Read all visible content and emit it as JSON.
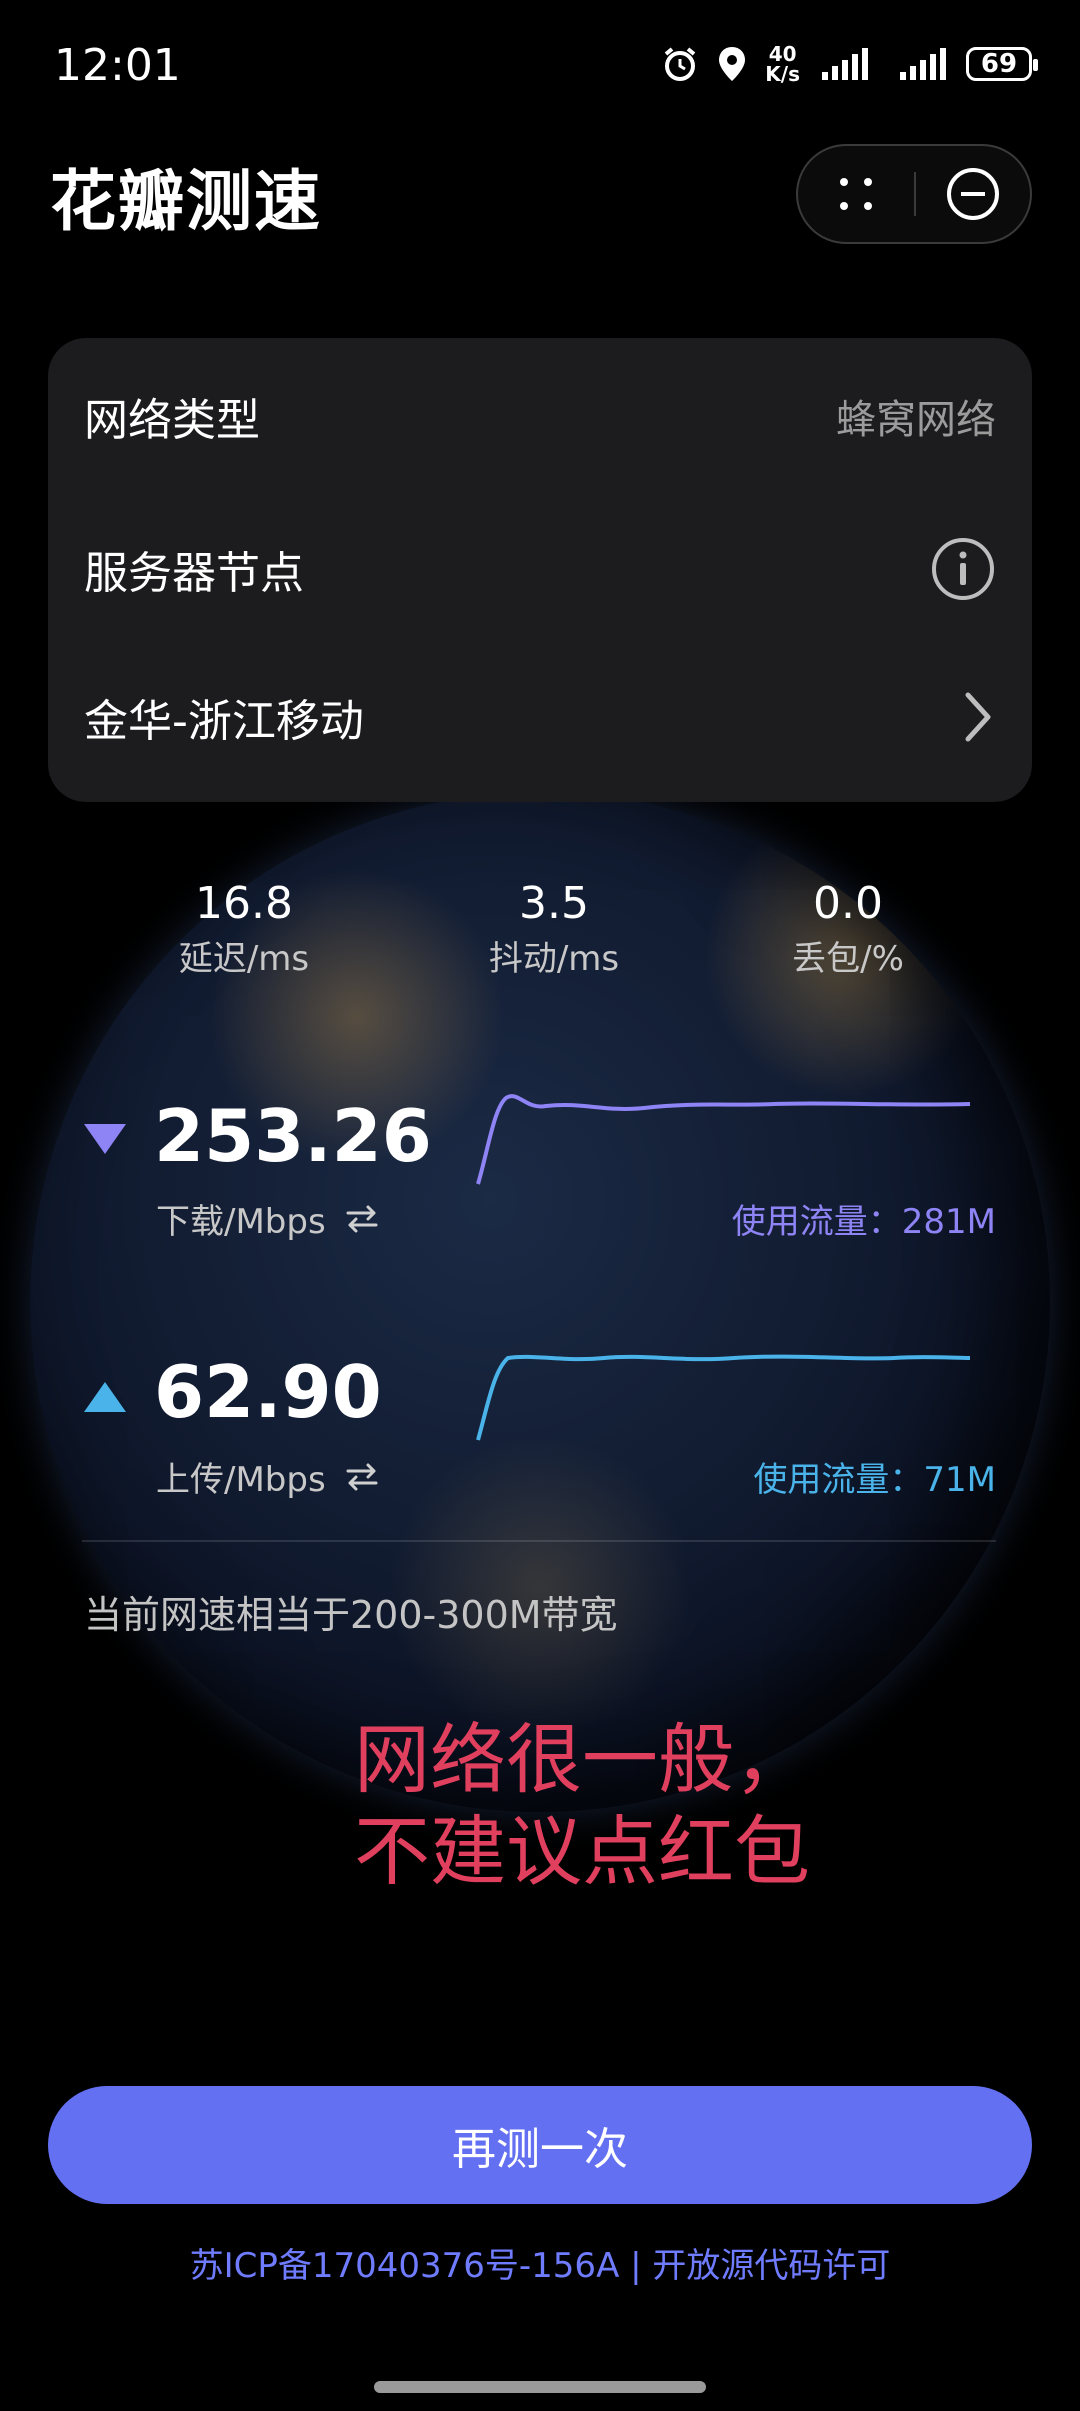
{
  "status_bar": {
    "time": "12:01",
    "net_speed_value": "40",
    "net_speed_unit": "K/s",
    "battery": "69",
    "icons": [
      "alarm-icon",
      "location-icon",
      "signal-icon",
      "signal-icon",
      "battery-icon"
    ]
  },
  "header": {
    "title": "花瓣测速",
    "more_icon": "more-dots-icon",
    "close_icon": "close-circle-icon"
  },
  "network_card": {
    "type_label": "网络类型",
    "type_value": "蜂窝网络",
    "server_label": "服务器节点",
    "server_info_icon": "info-icon",
    "server_name": "金华-浙江移动",
    "server_chevron_icon": "chevron-right-icon"
  },
  "metrics": {
    "latency": {
      "value": "16.8",
      "label": "延迟/ms"
    },
    "jitter": {
      "value": "3.5",
      "label": "抖动/ms"
    },
    "loss": {
      "value": "0.0",
      "label": "丢包/%"
    }
  },
  "download": {
    "value": "253.26",
    "label": "下载/Mbps",
    "traffic": "使用流量：281M",
    "color": "#8f84f5"
  },
  "upload": {
    "value": "62.90",
    "label": "上传/Mbps",
    "traffic": "使用流量：71M",
    "color": "#4ab3ea"
  },
  "bandwidth_note": "当前网速相当于200-300M带宽",
  "warning": {
    "line1": "网络很一般，",
    "line2": "不建议点红包",
    "color": "#e0405e"
  },
  "retest_button": "再测一次",
  "icp": "苏ICP备17040376号-156A | 开放源代码许可",
  "accent_color": "#6470f2"
}
